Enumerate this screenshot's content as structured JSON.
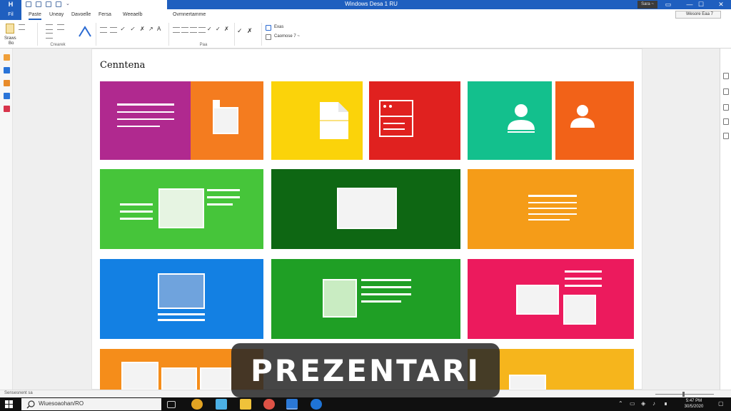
{
  "window": {
    "title": "Windows Desa 1 RU",
    "account_label": "Sara ~",
    "minimize_icon": "minimize-icon",
    "maximize_icon": "maximize-icon",
    "close_icon": "close-icon"
  },
  "ribbon": {
    "file_tab": "Fil",
    "tabs": [
      "Paste",
      "Uneay",
      "Davoelle",
      "Fersa",
      "Weeaelb",
      "Ovmnertamme"
    ],
    "share_label": "Wesore Eaa 7",
    "groups": [
      {
        "label": "Sraws",
        "sub": "Bo"
      },
      {
        "label": "Crearek"
      },
      {
        "label": "Paa"
      },
      {
        "label": "Exas",
        "sub": "Caomose 7 ~"
      }
    ]
  },
  "slide": {
    "title": "Cenntena"
  },
  "tiles": {
    "colors": {
      "purple": "#b0298f",
      "orange": "#f47c1f",
      "yellow": "#fbd30a",
      "red": "#e0211f",
      "teal": "#13c08d",
      "orange_red": "#f26218",
      "green": "#46c53a",
      "dark_green": "#0e6713",
      "orange2": "#f59c18",
      "blue": "#1380e3",
      "green2": "#1f9f25",
      "pink": "#ec1a5d",
      "bottom_orange": "#f58d1a",
      "bottom_yellow": "#f6b51c"
    },
    "icons": {
      "tile_document": "document-icon",
      "tile_folder": "folder-icon",
      "tile_window": "browser-window-icon",
      "tile_user_1": "user-icon",
      "tile_user_2": "user-icon",
      "tile_image": "image-icon"
    }
  },
  "status": {
    "left_text": "Sensesnent sa"
  },
  "taskbar": {
    "search_text": "Wiuesoaohan/RO",
    "start_icon": "windows-start-icon",
    "search_icon": "search-icon",
    "clock_time": "5:47 PM",
    "clock_date": "30/5/2020"
  },
  "banner": {
    "text": "PREZENTARI"
  }
}
